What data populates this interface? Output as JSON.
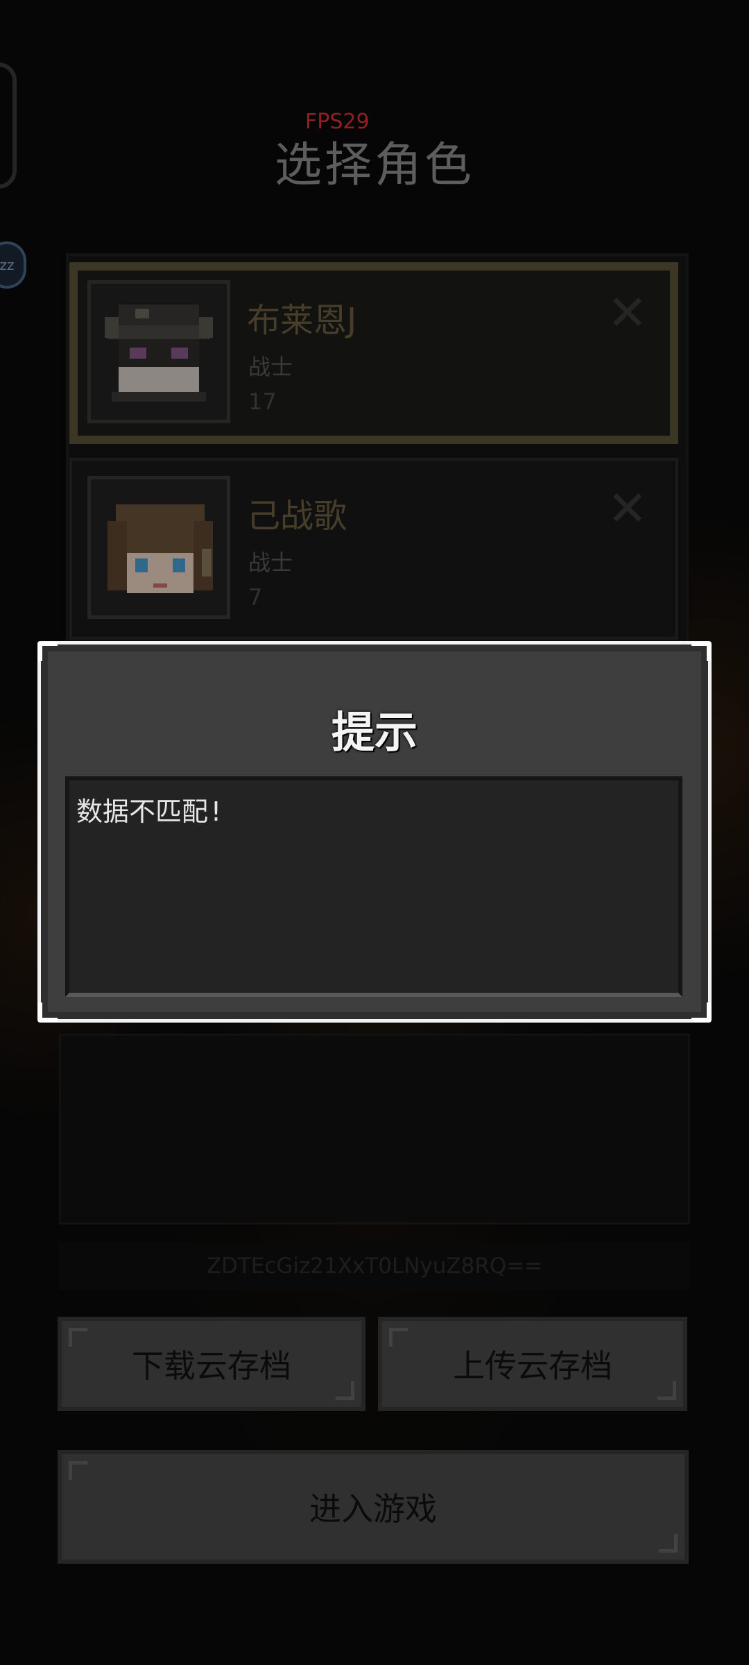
{
  "hud": {
    "fps": "FPS29"
  },
  "page": {
    "title": "选择角色"
  },
  "side": {
    "sleep_label": "zz"
  },
  "characters": [
    {
      "name": "布莱恩J",
      "class": "战士",
      "level": "17",
      "selected": true,
      "delete_icon": "close-icon"
    },
    {
      "name": "己战歌",
      "class": "战士",
      "level": "7",
      "selected": false,
      "delete_icon": "close-icon"
    }
  ],
  "save_code": "ZDTEcGiz21XxT0LNyuZ8RQ==",
  "buttons": {
    "download": "下载云存档",
    "upload": "上传云存档",
    "enter": "进入游戏"
  },
  "dialog": {
    "title": "提示",
    "message": "数据不匹配!"
  },
  "colors": {
    "selected_border": "#5c5339",
    "name_gold": "#6e5f3f",
    "fps_red": "#e0303a",
    "dialog_border": "#f2f2f2"
  }
}
